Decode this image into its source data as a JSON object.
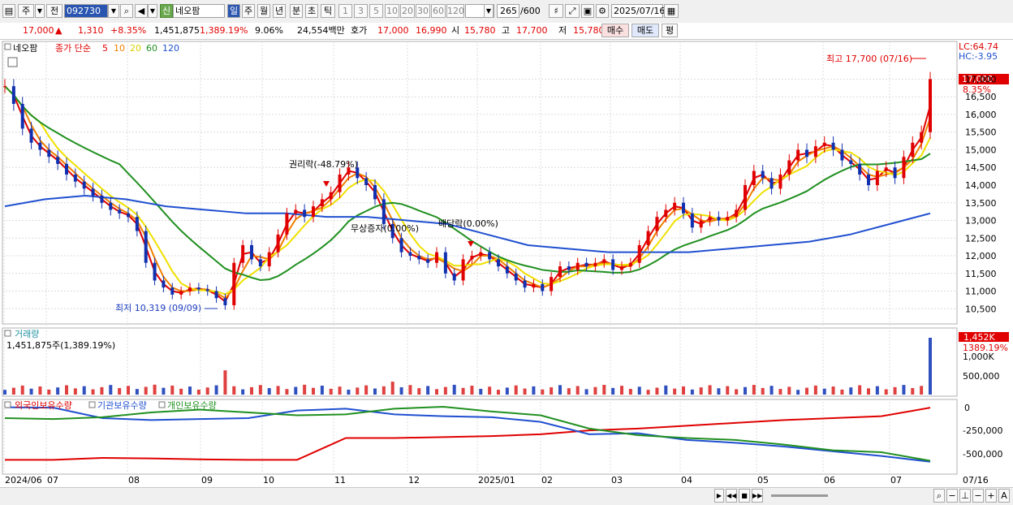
{
  "toolbar": {
    "menu_left": "주",
    "menu_mid": "전",
    "code_value": "092730",
    "search_icon": "search-icon",
    "sound_icon": "speaker-icon",
    "badge_new": "신",
    "stock_name": "네오팜",
    "period_tabs": [
      "일",
      "주",
      "월",
      "년",
      "분",
      "초",
      "틱"
    ],
    "selected_period": "일",
    "interval_buttons": [
      "1",
      "3",
      "5",
      "10",
      "20",
      "30",
      "60",
      "120"
    ],
    "count_display": "265",
    "count_total": "/600",
    "date_value": "2025/07/16"
  },
  "quote": {
    "price": "17,000",
    "change_arrow": "▲",
    "change": "1,310",
    "change_pct": "+8.35%",
    "volume": "1,451,875",
    "volume_ratio": "1,389.19%",
    "turnover": "9.06%",
    "amount": "24,554백만",
    "bid_label": "호가",
    "ask_price": "17,000",
    "bid_price": "16,990",
    "open_label": "시",
    "open": "15,780",
    "high_label": "고",
    "high": "17,700",
    "low_label": "저",
    "low": "15,780",
    "buy_btn": "매수",
    "sell_btn": "매도",
    "eval_btn": "평"
  },
  "price_panel": {
    "stock_label": "네오팜",
    "ma_title": "종가 단순",
    "ma_periods": [
      "5",
      "10",
      "20",
      "60",
      "120"
    ],
    "ma_colors": [
      "#e00000",
      "#f08000",
      "#f0f000",
      "#209020",
      "#2050d0"
    ],
    "lc_label": "LC:64.74",
    "hc_label": "HC:-3.95",
    "high_annotation": "최고 17,700 (07/16)",
    "low_annotation": "최저 10,319 (09/09)",
    "event_rights": "권리락(-48.79%)",
    "event_bonus": "무상증자(0.00%)",
    "event_dividend": "배당락(0.00%)",
    "last_price_tag": "17,000",
    "last_pct_tag": "8.35%",
    "y_ticks": [
      "17,000",
      "16,500",
      "16,000",
      "15,500",
      "15,000",
      "14,500",
      "14,000",
      "13,500",
      "13,000",
      "12,500",
      "12,000",
      "11,500",
      "11,000",
      "10,500"
    ]
  },
  "volume_panel": {
    "title": "거래량",
    "value_text": "1,451,875주(1,389.19%)",
    "tag_value": "1,452K",
    "tag_pct": "1389.19%",
    "y_ticks": [
      "1,000K",
      "500,000"
    ]
  },
  "holding_panel": {
    "legend": [
      "외국인보유수량",
      "기관보유수량",
      "개인보유수량"
    ],
    "legend_colors": [
      "#e00000",
      "#2050d0",
      "#209020"
    ],
    "y_ticks": [
      "0",
      "-250,000",
      "-500,000"
    ]
  },
  "x_axis": {
    "labels": [
      "2024/06",
      "07",
      "08",
      "09",
      "10",
      "11",
      "12",
      "2025/01",
      "02",
      "03",
      "04",
      "05",
      "06",
      "07"
    ],
    "last_label": "07/16"
  },
  "chart_data": {
    "type": "line",
    "candles_close_approx": [
      16800,
      16300,
      15600,
      15200,
      15000,
      14800,
      14600,
      14300,
      14100,
      13900,
      13700,
      13500,
      13300,
      13200,
      13100,
      12700,
      11800,
      11300,
      11100,
      10900,
      11000,
      11100,
      11050,
      11000,
      10800,
      10600,
      11800,
      12300,
      11900,
      11700,
      12100,
      12600,
      13200,
      13300,
      13100,
      13400,
      13600,
      13800,
      14300,
      14500,
      14200,
      14000,
      13600,
      12900,
      12500,
      12100,
      12000,
      11900,
      11800,
      12100,
      11500,
      11300,
      11900,
      12000,
      12100,
      11900,
      11700,
      11500,
      11300,
      11100,
      11200,
      11000,
      11400,
      11700,
      11600,
      11800,
      11700,
      11800,
      11900,
      11600,
      11700,
      11800,
      12300,
      12700,
      13100,
      13300,
      13500,
      13200,
      12800,
      13000,
      13100,
      13000,
      13100,
      13300,
      14000,
      14400,
      14200,
      13900,
      14300,
      14700,
      15000,
      14800,
      15100,
      15200,
      15000,
      14700,
      14600,
      14300,
      14000,
      14400,
      14500,
      14200,
      14800,
      15200,
      15500,
      17000
    ],
    "ma120_approx": [
      13400,
      13600,
      13700,
      13600,
      13400,
      13300,
      13200,
      13200,
      13100,
      13100,
      13000,
      12900,
      12600,
      12300,
      12200,
      12100,
      12100,
      12100,
      12200,
      12300,
      12400,
      12600,
      12900,
      13200
    ],
    "volume_spike_last": 1451875,
    "price_ylim": [
      10300,
      17700
    ]
  }
}
